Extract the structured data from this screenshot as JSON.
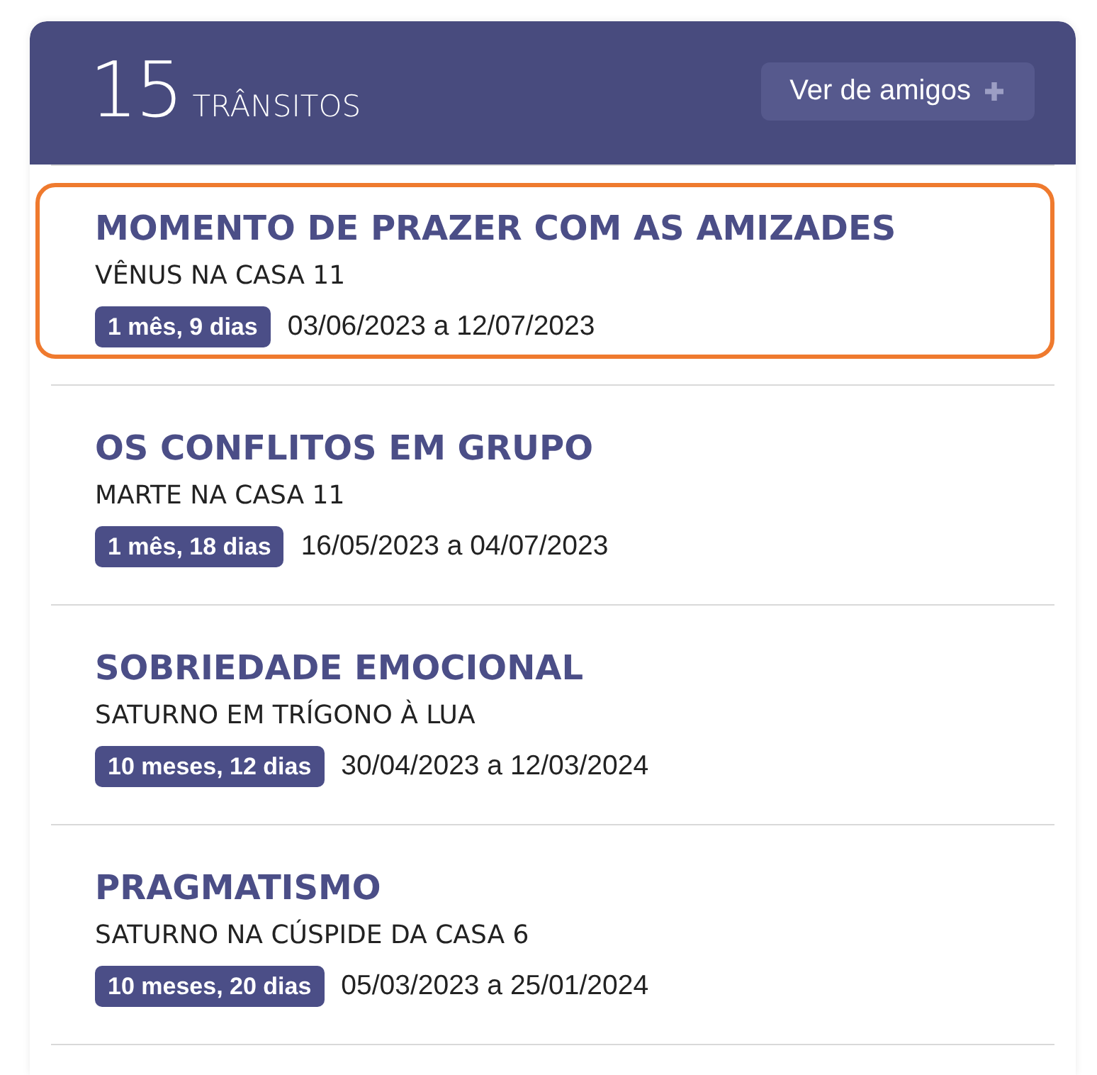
{
  "header": {
    "count": "15",
    "label": "TRÂNSITOS",
    "button": "Ver de amigos"
  },
  "transits": [
    {
      "title": "MOMENTO DE PRAZER COM AS AMIZADES",
      "subtitle": "VÊNUS NA CASA 11",
      "duration": "1 mês, 9 dias",
      "dates": "03/06/2023 a 12/07/2023",
      "selected": true
    },
    {
      "title": "OS CONFLITOS EM GRUPO",
      "subtitle": "MARTE NA CASA 11",
      "duration": "1 mês, 18 dias",
      "dates": "16/05/2023 a 04/07/2023",
      "selected": false
    },
    {
      "title": "SOBRIEDADE EMOCIONAL",
      "subtitle": "SATURNO EM TRÍGONO À LUA",
      "duration": "10 meses, 12 dias",
      "dates": "30/04/2023 a 12/03/2024",
      "selected": false
    },
    {
      "title": "PRAGMATISMO",
      "subtitle": "SATURNO NA CÚSPIDE DA CASA 6",
      "duration": "10 meses, 20 dias",
      "dates": "05/03/2023 a 25/01/2024",
      "selected": false
    }
  ]
}
